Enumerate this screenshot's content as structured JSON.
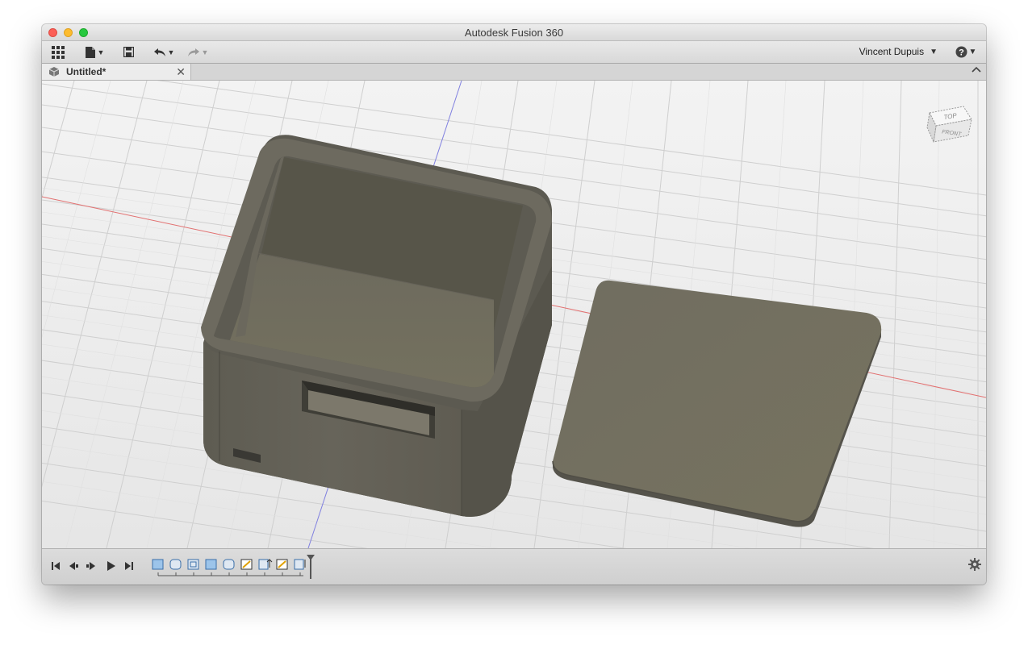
{
  "window": {
    "title": "Autodesk Fusion 360"
  },
  "toolbar": {
    "apps_icon": "grid-icon",
    "file_icon": "file-icon",
    "save_icon": "save-icon",
    "undo_icon": "undo-icon",
    "redo_icon": "redo-icon",
    "user_name": "Vincent Dupuis",
    "help_icon": "help-icon"
  },
  "tab": {
    "title": "Untitled*",
    "close_icon": "close-icon"
  },
  "viewcube": {
    "top_label": "TOP",
    "front_label": "FRONT"
  },
  "timeline": {
    "controls": [
      "skip-start-icon",
      "step-back-icon",
      "step-forward-icon",
      "play-icon",
      "skip-end-icon"
    ],
    "features": [
      "extrude",
      "fillet",
      "shell",
      "extrude",
      "fillet",
      "sketch",
      "extrude-cut",
      "sketch",
      "extrude-cut"
    ]
  },
  "colors": {
    "model": "#706c60",
    "grid_bg": "#ececec",
    "axis_red": "#e26a6a",
    "axis_blue": "#7a7ae0",
    "accent": "#4a8bd0"
  }
}
